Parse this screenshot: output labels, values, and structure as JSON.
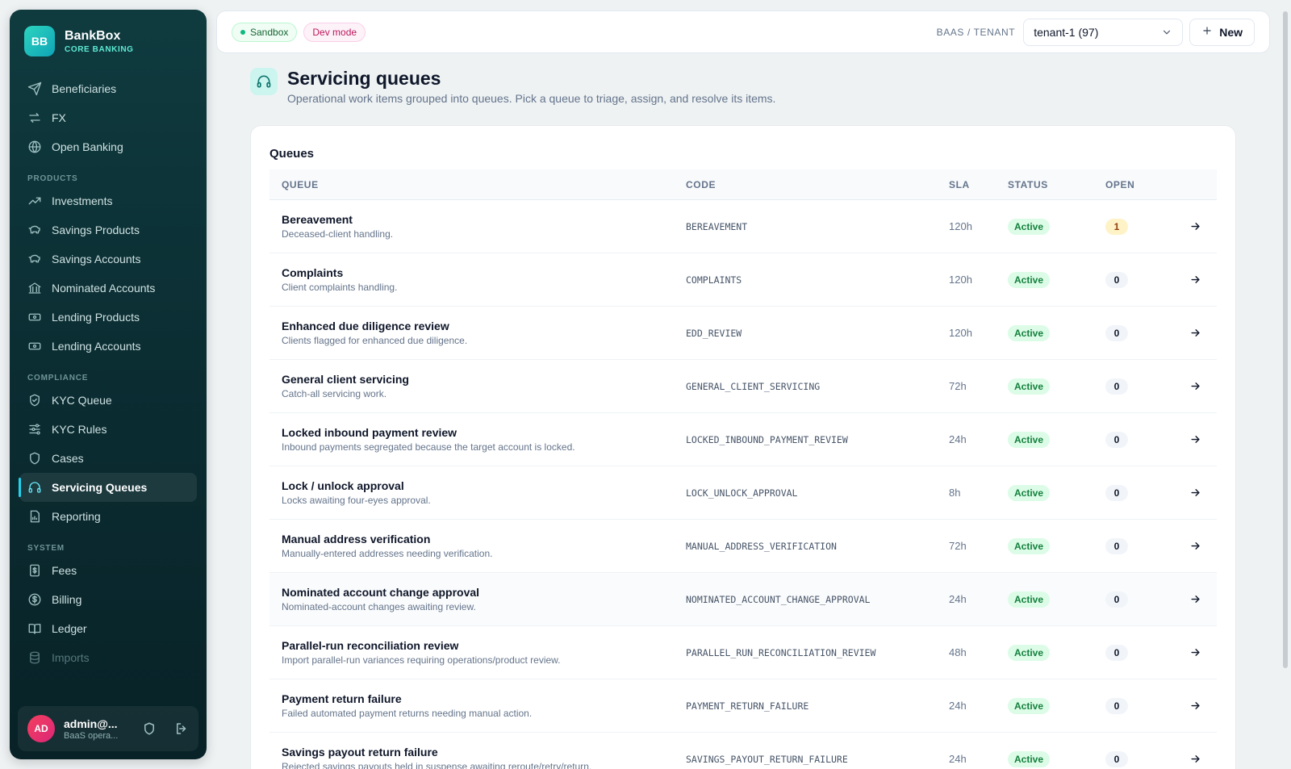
{
  "brand": {
    "logo": "BB",
    "name": "BankBox",
    "subtitle": "CORE BANKING"
  },
  "nav_top": [
    {
      "label": "Beneficiaries",
      "icon": "send-icon"
    },
    {
      "label": "FX",
      "icon": "exchange-icon"
    },
    {
      "label": "Open Banking",
      "icon": "globe-icon"
    }
  ],
  "sections": {
    "products": "PRODUCTS",
    "compliance": "COMPLIANCE",
    "system": "SYSTEM"
  },
  "nav_products": [
    {
      "label": "Investments",
      "icon": "trend-up-icon"
    },
    {
      "label": "Savings Products",
      "icon": "piggy-bank-icon"
    },
    {
      "label": "Savings Accounts",
      "icon": "piggy-bank-icon"
    },
    {
      "label": "Nominated Accounts",
      "icon": "bank-icon"
    },
    {
      "label": "Lending Products",
      "icon": "banknote-icon"
    },
    {
      "label": "Lending Accounts",
      "icon": "banknote-icon"
    }
  ],
  "nav_compliance": [
    {
      "label": "KYC Queue",
      "icon": "shield-check-icon"
    },
    {
      "label": "KYC Rules",
      "icon": "sliders-icon"
    },
    {
      "label": "Cases",
      "icon": "shield-icon"
    },
    {
      "label": "Servicing Queues",
      "icon": "headset-icon",
      "active": true
    },
    {
      "label": "Reporting",
      "icon": "report-icon"
    }
  ],
  "nav_system": [
    {
      "label": "Fees",
      "icon": "receipt-icon"
    },
    {
      "label": "Billing",
      "icon": "dollar-circle-icon"
    },
    {
      "label": "Ledger",
      "icon": "book-icon"
    },
    {
      "label": "Imports",
      "icon": "database-icon",
      "dim": true
    }
  ],
  "user": {
    "initials": "AD",
    "name": "admin@...",
    "role": "BaaS opera..."
  },
  "topbar": {
    "sandbox": "Sandbox",
    "dev_mode": "Dev mode",
    "tenant_label": "BAAS / TENANT",
    "tenant_value": "tenant-1 (97)",
    "new_label": "New"
  },
  "page": {
    "title": "Servicing queues",
    "subtitle": "Operational work items grouped into queues. Pick a queue to triage, assign, and resolve its items."
  },
  "card": {
    "title": "Queues"
  },
  "table": {
    "headers": {
      "queue": "QUEUE",
      "code": "CODE",
      "sla": "SLA",
      "status": "STATUS",
      "open": "OPEN"
    },
    "rows": [
      {
        "name": "Bereavement",
        "desc": "Deceased-client handling.",
        "code": "BEREAVEMENT",
        "sla": "120h",
        "status": "Active",
        "open": "1"
      },
      {
        "name": "Complaints",
        "desc": "Client complaints handling.",
        "code": "COMPLAINTS",
        "sla": "120h",
        "status": "Active",
        "open": "0"
      },
      {
        "name": "Enhanced due diligence review",
        "desc": "Clients flagged for enhanced due diligence.",
        "code": "EDD_REVIEW",
        "sla": "120h",
        "status": "Active",
        "open": "0"
      },
      {
        "name": "General client servicing",
        "desc": "Catch-all servicing work.",
        "code": "GENERAL_CLIENT_SERVICING",
        "sla": "72h",
        "status": "Active",
        "open": "0"
      },
      {
        "name": "Locked inbound payment review",
        "desc": "Inbound payments segregated because the target account is locked.",
        "code": "LOCKED_INBOUND_PAYMENT_REVIEW",
        "sla": "24h",
        "status": "Active",
        "open": "0"
      },
      {
        "name": "Lock / unlock approval",
        "desc": "Locks awaiting four-eyes approval.",
        "code": "LOCK_UNLOCK_APPROVAL",
        "sla": "8h",
        "status": "Active",
        "open": "0"
      },
      {
        "name": "Manual address verification",
        "desc": "Manually-entered addresses needing verification.",
        "code": "MANUAL_ADDRESS_VERIFICATION",
        "sla": "72h",
        "status": "Active",
        "open": "0"
      },
      {
        "name": "Nominated account change approval",
        "desc": "Nominated-account changes awaiting review.",
        "code": "NOMINATED_ACCOUNT_CHANGE_APPROVAL",
        "sla": "24h",
        "status": "Active",
        "open": "0"
      },
      {
        "name": "Parallel-run reconciliation review",
        "desc": "Import parallel-run variances requiring operations/product review.",
        "code": "PARALLEL_RUN_RECONCILIATION_REVIEW",
        "sla": "48h",
        "status": "Active",
        "open": "0"
      },
      {
        "name": "Payment return failure",
        "desc": "Failed automated payment returns needing manual action.",
        "code": "PAYMENT_RETURN_FAILURE",
        "sla": "24h",
        "status": "Active",
        "open": "0"
      },
      {
        "name": "Savings payout return failure",
        "desc": "Rejected savings payouts held in suspense awaiting reroute/retry/return.",
        "code": "SAVINGS_PAYOUT_RETURN_FAILURE",
        "sla": "24h",
        "status": "Active",
        "open": "0"
      }
    ]
  },
  "colors": {
    "accent": "#22d3ee",
    "active_status": "#15803d",
    "sidebar_bg": "#0b2e33"
  }
}
